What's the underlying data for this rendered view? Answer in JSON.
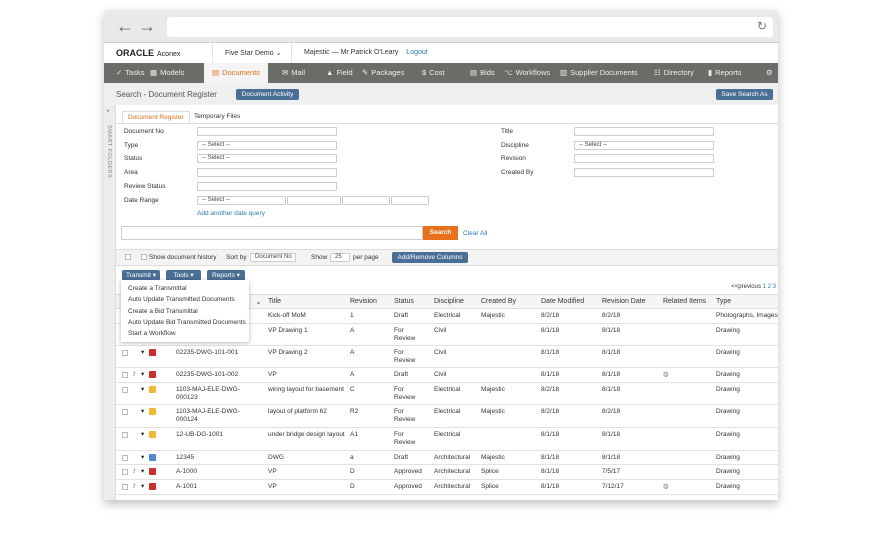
{
  "header": {
    "logo": "ORACLE",
    "logo_sub": "Aconex",
    "project": "Five Star Demo",
    "org": "Majestic",
    "separator": "—",
    "user": "Mr Patrick O'Leary",
    "logout": "Logout"
  },
  "nav": [
    {
      "label": "Tasks",
      "icon": "✓"
    },
    {
      "label": "Models",
      "icon": "▦"
    },
    {
      "label": "Documents",
      "icon": "▤"
    },
    {
      "label": "Mail",
      "icon": "✉"
    },
    {
      "label": "Field",
      "icon": "▲"
    },
    {
      "label": "Packages",
      "icon": "✎"
    },
    {
      "label": "Cost",
      "icon": "$"
    },
    {
      "label": "Bids",
      "icon": "▤"
    },
    {
      "label": "Workflows",
      "icon": "⌥"
    },
    {
      "label": "Supplier Documents",
      "icon": "▥"
    },
    {
      "label": "Directory",
      "icon": "☷"
    },
    {
      "label": "Reports",
      "icon": "▮"
    }
  ],
  "sub": {
    "title": "Search - Document Register",
    "activity": "Document Activity",
    "save_search": "Save Search As"
  },
  "sidebar": {
    "label": "SMART FOLDERS"
  },
  "tabs": [
    "Document Register",
    "Temporary Files"
  ],
  "form": {
    "document_no": "Document No",
    "type": "Type",
    "status": "Status",
    "area": "Area",
    "review_status": "Review Status",
    "date_range": "Date Range",
    "title": "Title",
    "discipline": "Discipline",
    "revision": "Revision",
    "created_by": "Created By",
    "select": "-- Select --",
    "add_date": "Add another date query",
    "search": "Search",
    "clear": "Clear All"
  },
  "toolbar": {
    "show_history": "Show document history",
    "sort_by": "Sort by",
    "sort_value": "Document No",
    "show": "Show",
    "per_page_value": "25",
    "per_page": "per page",
    "add_remove": "Add/Remove Columns"
  },
  "actions": {
    "transmit": "Transmit",
    "tools": "Tools",
    "reports": "Reports"
  },
  "menu": [
    "Create a Transmittal",
    "Auto Update Transmitted Documents",
    "Create a Bid Transmittal",
    "Auto Update Bid Transmitted Documents",
    "Start a Workflow"
  ],
  "pagination": {
    "prev": "<<previous",
    "pages": [
      "1",
      "2",
      "3"
    ]
  },
  "columns": [
    "Title",
    "Revision",
    "Status",
    "Discipline",
    "Created By",
    "Date Modified",
    "Revision Date",
    "Related Items",
    "Type"
  ],
  "colors": {
    "accent": "#e8701a",
    "nav": "#6b6b67",
    "button": "#4a6f96",
    "link": "#2a7ab8",
    "pdf": "#d22b2b",
    "folder": "#f5b82e",
    "dwg": "#4a8ad8"
  },
  "rows": [
    {
      "flag": "",
      "icon": "pdf",
      "docno": "",
      "title": "Kick-off MoM",
      "rev": "1",
      "status": "Draft",
      "disc": "Electrical",
      "by": "Majestic",
      "mod": "8/2/18",
      "revdate": "8/2/18",
      "related": false,
      "type": "Photographs, Images"
    },
    {
      "flag": "",
      "icon": "pdf",
      "docno": "",
      "title": "VP Drawing 1",
      "rev": "A",
      "status": "For Review",
      "disc": "Civil",
      "by": "",
      "mod": "8/1/18",
      "revdate": "8/1/18",
      "related": false,
      "type": "Drawing"
    },
    {
      "flag": "",
      "icon": "pdf",
      "docno": "02235-DWG-101-001",
      "title": "VP Drawing 2",
      "rev": "A",
      "status": "For Review",
      "disc": "Civil",
      "by": "",
      "mod": "8/1/18",
      "revdate": "8/1/18",
      "related": false,
      "type": "Drawing"
    },
    {
      "flag": "!",
      "icon": "pdf",
      "docno": "02235-DWG-101-002",
      "title": "VP",
      "rev": "A",
      "status": "Draft",
      "disc": "Civil",
      "by": "",
      "mod": "8/1/18",
      "revdate": "8/1/18",
      "related": true,
      "type": "Drawing"
    },
    {
      "flag": "",
      "icon": "folder",
      "docno": "1103-MAJ-ELE-DWG-000123",
      "title": "wiring layout for basement",
      "rev": "C",
      "status": "For Review",
      "disc": "Electrical",
      "by": "Majestic",
      "mod": "8/2/18",
      "revdate": "8/1/18",
      "related": false,
      "type": "Drawing"
    },
    {
      "flag": "",
      "icon": "folder",
      "docno": "1103-MAJ-ELE-DWG-000124",
      "title": "layout of platform 62",
      "rev": "R2",
      "status": "For Review",
      "disc": "Electrical",
      "by": "Majestic",
      "mod": "8/2/18",
      "revdate": "8/2/18",
      "related": false,
      "type": "Drawing"
    },
    {
      "flag": "",
      "icon": "folder",
      "docno": "12-UB-DG-1001",
      "title": "under bridge design layout",
      "rev": "A1",
      "status": "For Review",
      "disc": "Electrical",
      "by": "",
      "mod": "8/1/18",
      "revdate": "8/1/18",
      "related": false,
      "type": "Drawing"
    },
    {
      "flag": "",
      "icon": "dwg",
      "docno": "12345",
      "title": "DWG",
      "rev": "a",
      "status": "Draft",
      "disc": "Architectural",
      "by": "Majestic",
      "mod": "8/1/18",
      "revdate": "8/1/18",
      "related": false,
      "type": "Drawing"
    },
    {
      "flag": "!",
      "icon": "pdf",
      "docno": "A-1000",
      "title": "VP",
      "rev": "D",
      "status": "Approved",
      "disc": "Architectural",
      "by": "Splice",
      "mod": "8/1/18",
      "revdate": "7/5/17",
      "related": false,
      "type": "Drawing"
    },
    {
      "flag": "!",
      "icon": "pdf",
      "docno": "A-1001",
      "title": "VP",
      "rev": "D",
      "status": "Approved",
      "disc": "Architectural",
      "by": "Splice",
      "mod": "8/1/18",
      "revdate": "7/12/17",
      "related": true,
      "type": "Drawing"
    }
  ]
}
